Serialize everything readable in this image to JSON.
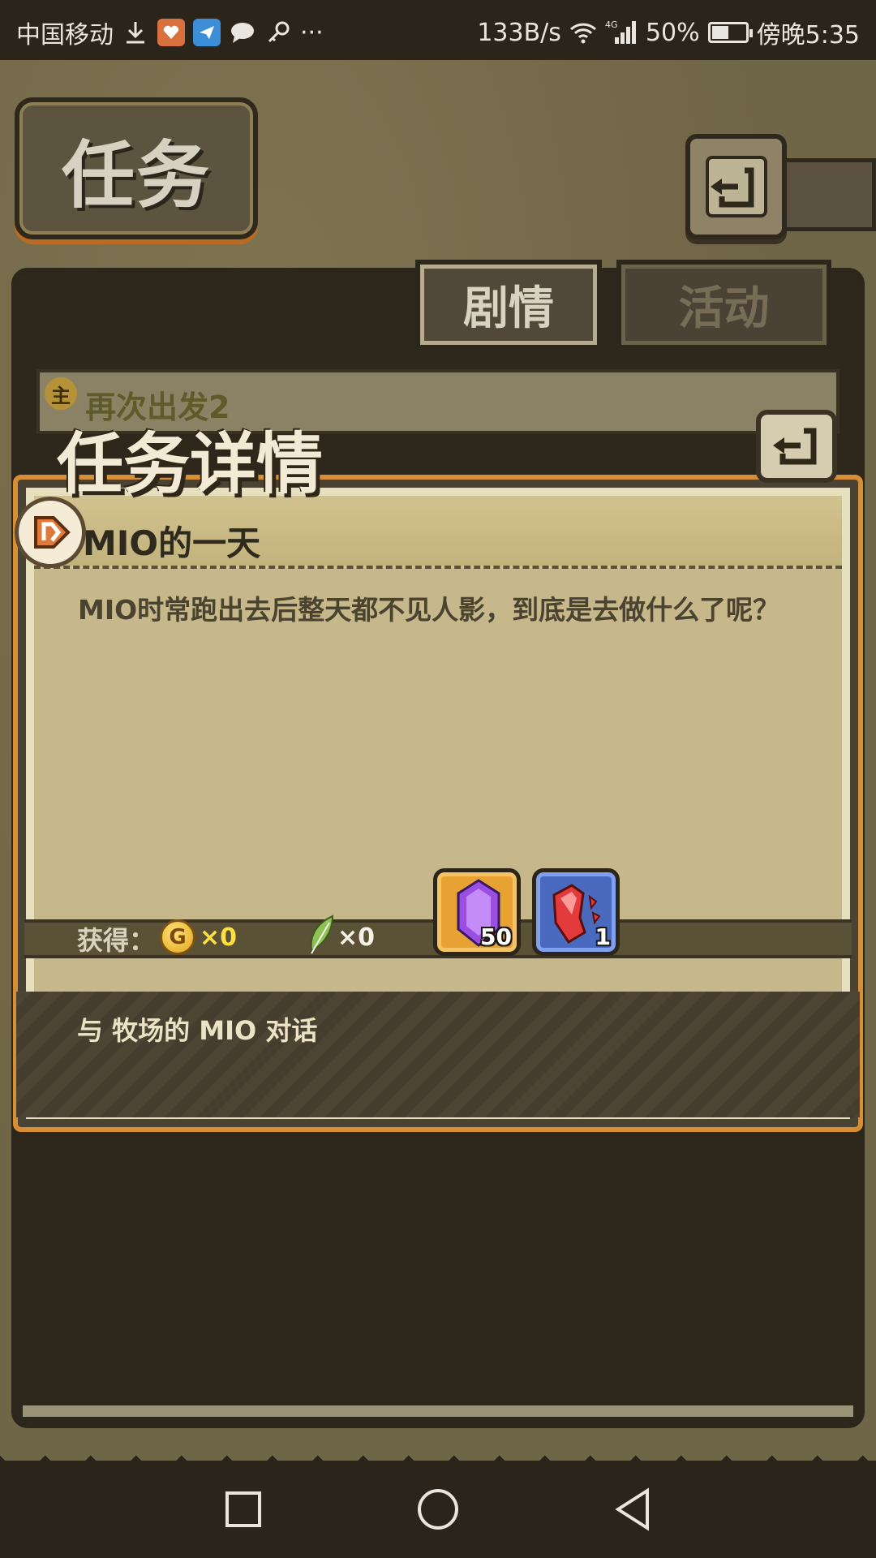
{
  "status_bar": {
    "carrier": "中国移动",
    "net_speed": "133B/s",
    "network": "4G",
    "battery": "50%",
    "battery_level": 0.5,
    "time": "傍晚5:35",
    "icons": [
      "download-icon",
      "app-icon",
      "app-icon",
      "chat-icon",
      "key-icon",
      "more-icon",
      "wifi-icon",
      "signal-icon",
      "battery-icon"
    ],
    "more": "···"
  },
  "header": {
    "title": "任务",
    "back_icon": "back-icon"
  },
  "tabs": [
    {
      "label": "剧情",
      "active": true
    },
    {
      "label": "活动",
      "active": false
    }
  ],
  "quest_list": {
    "badge": "主",
    "first_item": "再次出发2"
  },
  "details": {
    "title": "任务详情",
    "quest_name": "MIO的一天",
    "description": "MIO时常跑出去后整天都不见人影，到底是去做什么了呢？",
    "reward_label": "获得：",
    "coin_symbol": "G",
    "coin_amount": "×0",
    "feather_amount": "×0",
    "items": [
      {
        "icon": "purple-gem-icon",
        "qty": "50"
      },
      {
        "icon": "red-shard-icon",
        "qty": "1"
      }
    ],
    "objective": "与 牧场的 MIO 对话"
  },
  "colors": {
    "accent_orange": "#d88e33",
    "coin_yellow": "#ffe03a",
    "panel_paper": "#c6b88a"
  }
}
